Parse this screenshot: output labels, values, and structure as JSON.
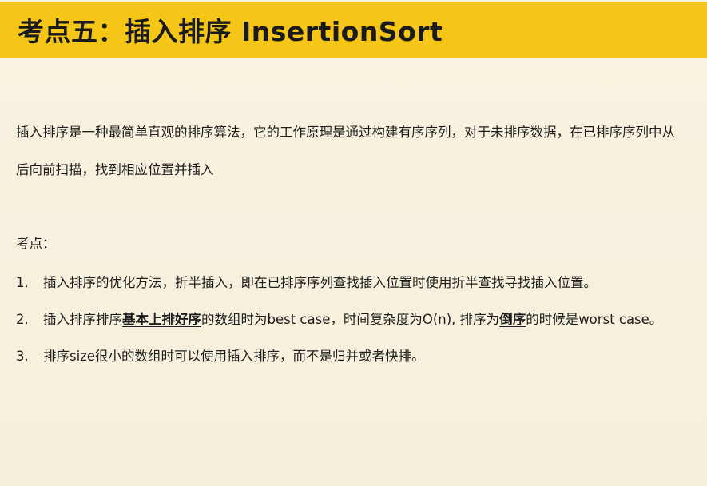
{
  "title": "考点五：插入排序 InsertionSort",
  "intro": "插入排序是一种最简单直观的排序算法，它的工作原理是通过构建有序序列，对于未排序数据，在已排序序列中从后向前扫描，找到相应位置并插入",
  "kaodian_label": "考点：",
  "points": [
    {
      "number": "1.",
      "parts": [
        "插入排序的优化方法，折半插入，即在已排序序列查找插入位置时使用折半查找寻找插入位置。"
      ]
    },
    {
      "number": "2.",
      "parts": [
        "插入排序排序",
        "基本上排好序",
        "的数组时为best case，时间复杂度为O(n), 排序为",
        "倒序",
        "的时候是worst case。"
      ]
    },
    {
      "number": "3.",
      "parts": [
        "排序size很小的数组时可以使用插入排序，而不是归并或者快排。"
      ]
    }
  ]
}
